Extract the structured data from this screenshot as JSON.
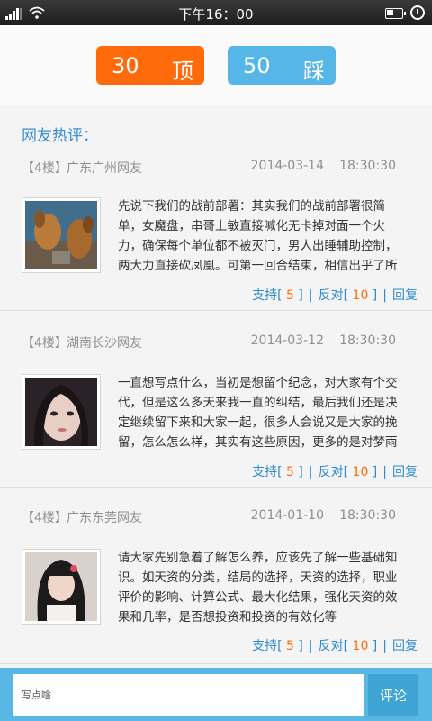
{
  "status_bar": {
    "time": "下午16：00",
    "icons": [
      "signal-icon",
      "wifi-icon",
      "battery-icon",
      "alarm-icon"
    ]
  },
  "votes": {
    "up": {
      "count": "30",
      "label": "顶",
      "color": "#ff6a0a"
    },
    "down": {
      "count": "50",
      "label": "踩",
      "color": "#57b6e8"
    }
  },
  "section_title": "网友热评：",
  "comments": [
    {
      "floor": "【4楼】",
      "user": "广东广州网友",
      "date": "2014-03-14",
      "time": "18:30:30",
      "avatar": "dogs-avatar-image",
      "text": "先说下我们的战前部署：其实我们的战前部署很简单，女魔盘，串哥上敏直接喊化无卡掉对面一个火力，确保每个单位都不被灭门，男人出睡辅助控制，两大力直接砍凤凰。可第一回合结束，相信出乎了所有人",
      "support_label": "支持",
      "support_count": "5",
      "oppose_label": "反对",
      "oppose_count": "10",
      "reply_label": "回复"
    },
    {
      "floor": "【4楼】",
      "user": "湖南长沙网友",
      "date": "2014-03-12",
      "time": "18:30:30",
      "avatar": "girl-avatar-image",
      "text": "一直想写点什么，当初是想留个纪念，对大家有个交代，但是这么多天来我一直的纠结，最后我们还是决定继续留下来和大家一起，很多人会说又是大家的挽留，怎么怎么样，其实有这些原因，更多的是对梦雨",
      "support_label": "支持",
      "support_count": "5",
      "oppose_label": "反对",
      "oppose_count": "10",
      "reply_label": "回复"
    },
    {
      "floor": "【4楼】",
      "user": "广东东莞网友",
      "date": "2014-01-10",
      "time": "18:30:30",
      "avatar": "woman-avatar-image",
      "text": "请大家先别急着了解怎么养，应该先了解一些基础知识。如天资的分类，结局的选择，天资的选择，职业评价的影响、计算公式、最大化结果，强化天资的效果和几率，是否想投资和投资的有效化等",
      "support_label": "支持",
      "support_count": "5",
      "oppose_label": "反对",
      "oppose_count": "10",
      "reply_label": "回复"
    }
  ],
  "comment_bar": {
    "placeholder": "写点啥",
    "submit_label": "评论"
  }
}
